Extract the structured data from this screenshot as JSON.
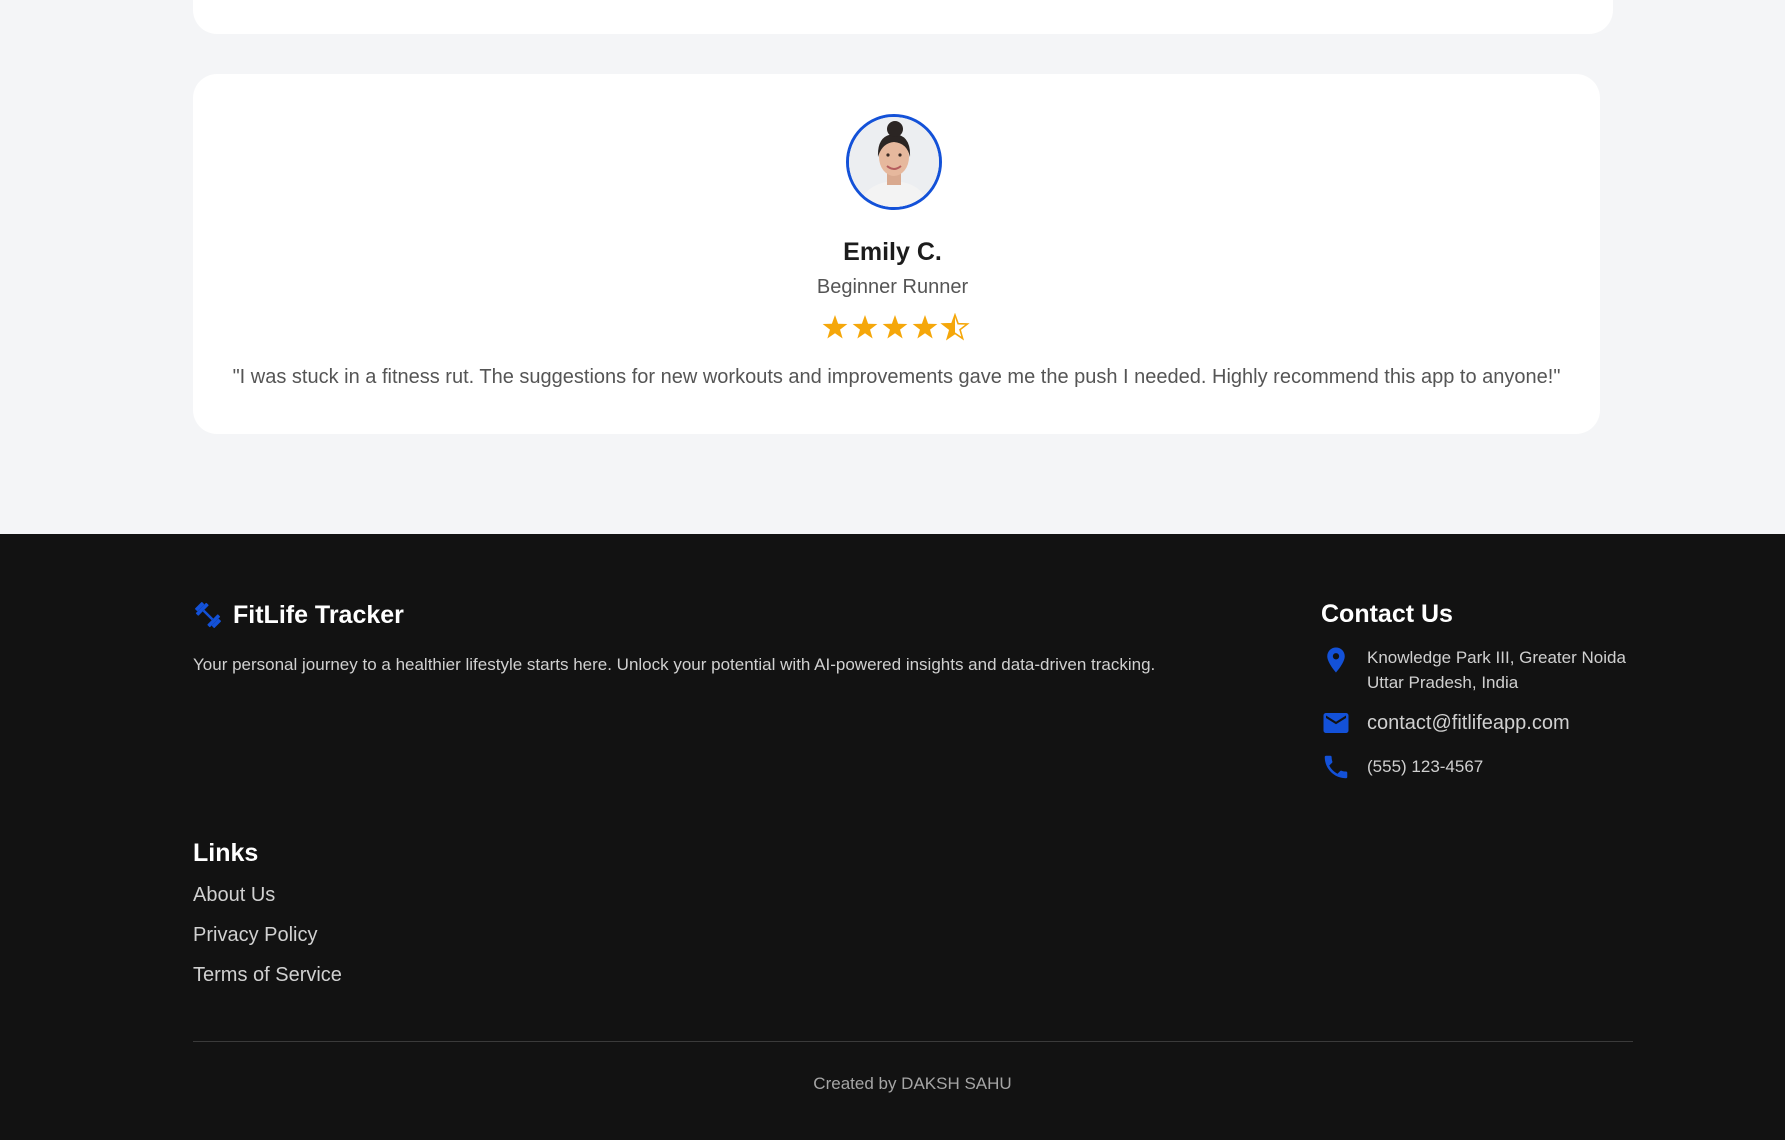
{
  "testimonial": {
    "name": "Emily C.",
    "role": "Beginner Runner",
    "rating": 4.5,
    "rating_max": 5,
    "quote": "\"I was stuck in a fitness rut. The suggestions for new workouts and improvements gave me the push I needed. Highly recommend this app to anyone!\"",
    "star_color": "#f5a70a",
    "avatar_border_color": "#1351d8"
  },
  "footer": {
    "brand": {
      "icon": "dumbbell-icon",
      "title": "FitLife Tracker",
      "description": "Your personal journey to a healthier lifestyle starts here. Unlock your potential with AI-powered insights and data-driven tracking."
    },
    "contact": {
      "title": "Contact Us",
      "address_line1": "Knowledge Park III, Greater Noida",
      "address_line2": "Uttar Pradesh, India",
      "email": "contact@fitlifeapp.com",
      "phone": "(555) 123-4567",
      "icon_color": "#1351d8"
    },
    "links": {
      "title": "Links",
      "items": [
        "About Us",
        "Privacy Policy",
        "Terms of Service"
      ]
    },
    "credit": "Created by DAKSH SAHU"
  },
  "colors": {
    "page_bg": "#f4f5f7",
    "footer_bg": "#121212",
    "accent": "#1351d8"
  }
}
